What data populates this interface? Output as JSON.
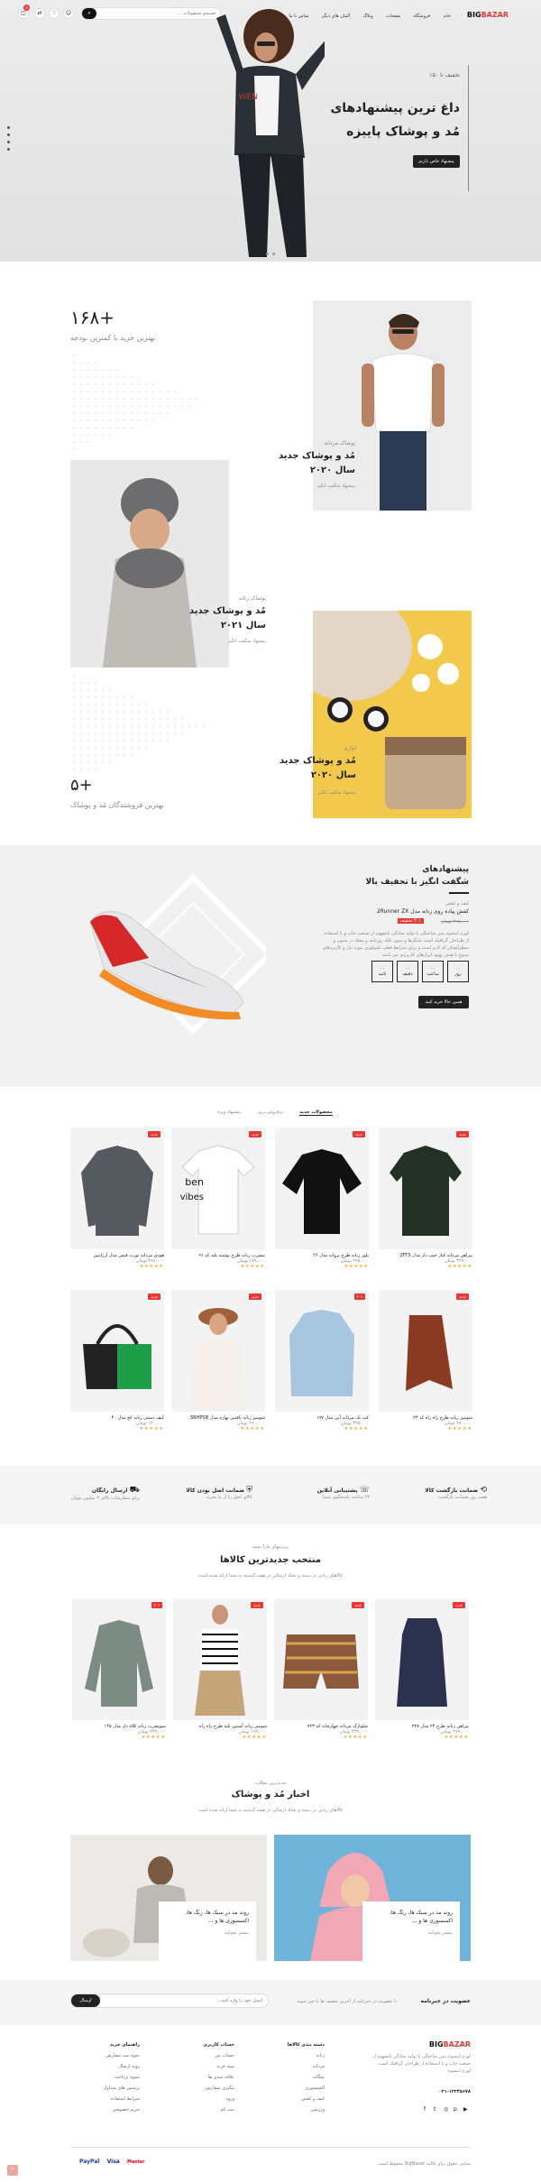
{
  "header": {
    "logo_main": "BIG",
    "logo_accent": "BAZAR",
    "nav": [
      "خانه",
      "فروشگاه",
      "صفحات",
      "وبلاگ",
      "المان های دیگر",
      "تماس با ما"
    ],
    "search_placeholder": "جستجو محصولات ...",
    "cart_count": "0"
  },
  "hero": {
    "eyebrow": "تخفیف تا ۵۰٪",
    "title_line1": "داغ ترین پیشنهادهای",
    "title_line2": "مُد و پوشاک پاییزه",
    "cta": "پیشنهاد خاص داریم"
  },
  "promo": {
    "stat1_value": "۱۶۸+",
    "stat1_label": "بهترین خرید با کمترین بودجه",
    "block1_kicker": "پوشاک مردانه",
    "block1_title1": "مُد و پوشاک جدید",
    "block1_title2": "سال ۲۰۲۰",
    "block1_link": "پیشنهاد شگفت انگیز",
    "block2_kicker": "پوشاک زنانه",
    "block2_title1": "مُد و پوشاک جدید",
    "block2_title2": "سال ۲۰۲۱",
    "block2_link": "پیشنهاد شگفت انگیز",
    "block3_kicker": "لوازم",
    "block3_title1": "مُد و پوشاک جدید",
    "block3_title2": "سال ۲۰۲۰",
    "block3_link": "پیشنهاد شگفت انگیز",
    "stat2_value": "۵+",
    "stat2_label": "بهترین فروشندگان مُد و پوشاک"
  },
  "deal": {
    "title1": "پیشنهادهای",
    "title2": "شگفت انگیز با تخفیف بالا",
    "kicker": "کیف و کفش",
    "product": "کفش پیاده روی زنانه مدل 2Runner ZX",
    "old_price": "۲۹۸,۰۰۰ تومان",
    "badge": "۳۰٪ تخفیف",
    "desc": "لورم ایپسوم متن ساختگی با تولید سادگی نامفهوم از صنعت چاپ و با استفاده از طراحان گرافیک است چاپگرها و متون بلکه روزنامه و مجله در ستون و سطرآنچنان که لازم است و برای شرایط فعلی تکنولوژی مورد نیاز و کاربردهای متنوع با هدف بهبود ابزارهای کاربردی می باشد",
    "countdown": [
      {
        "v": "۰۰",
        "l": "روز"
      },
      {
        "v": "۰۰",
        "l": "ساعت"
      },
      {
        "v": "۰۰",
        "l": "دقیقه"
      },
      {
        "v": "۰۰",
        "l": "ثانیه"
      }
    ],
    "cta": "همین حالا خرید کنید"
  },
  "tabs": [
    "محصولات جدید",
    "پرفروش ترین",
    "پیشنهاد ویژه"
  ],
  "products_grid": [
    {
      "name": "پیراهن مردانه کنار جیب دار مدل 2FTS",
      "price": "۳۳۸,۰۰۰ تومان",
      "tag": "جدید"
    },
    {
      "name": "بلوز زنانه طرح پروانه مدل ۴۶",
      "price": "۲۹۸,۰۰۰ تومان",
      "tag": "جدید"
    },
    {
      "name": "تیشرت زنانه طرح نوشته بلند کد ۹۱",
      "price": "۱۷۹,۰۰۰ تومان",
      "tag": "جدید"
    },
    {
      "name": "هودی مردانه نورث فیس مدل آرژانتین",
      "price": "۴۹۸,۰۰۰ تومان",
      "tag": "جدید"
    },
    {
      "name": "شومیز زنانه طرح راه راه کد ۲۳",
      "price": "۲۸۰,۰۰۰ تومان",
      "tag": "جدید"
    },
    {
      "name": "کت تک مردانه آبی مدل ۱۹۷",
      "price": "۳۴۵,۰۰۰ تومان",
      "tag": "۲۰٪"
    },
    {
      "name": "شومیز زنانه بافتنی بهاره مدل SBHPSN",
      "price": "۶۹۰,۰۰۰ تومان",
      "tag": "جدید"
    },
    {
      "name": "کیف دستی زنانه کج مدل ۴۰",
      "price": "۱۴۰,۰۰۰ تومان",
      "tag": "جدید"
    }
  ],
  "features": [
    {
      "title": "ضمانت بازگشت کالا",
      "sub": "هفت روز ضمانت بازگشت"
    },
    {
      "title": "پشتیبانی آنلاین",
      "sub": "۲۴ ساعت پاسخگوی شما"
    },
    {
      "title": "ضمانت اصل بودن کالا",
      "sub": "کالای اصل را از ما بخرید"
    },
    {
      "title": "ارسال رایگان",
      "sub": "برای سفارشات بالای ۲ میلیون تومان"
    }
  ],
  "selection": {
    "kicker": "برترینهای مارا ببینید",
    "title": "منتخب جدیدترین کالاها",
    "sub": "کالاهای زنانی در دسته و تعداد ارسالی در هفته گذشته به شما ارائه شده است",
    "items": [
      {
        "name": "پیراهن زنانه طرح ۲۴ مدل ۲۲۸",
        "price": "۲۶۹,۰۰۰ تومان",
        "tag": "جدید"
      },
      {
        "name": "شلوارک مردانه چهارخانه کد ۷۲۳",
        "price": "۲۳۹,۰۰۰ تومان",
        "tag": "جدید"
      },
      {
        "name": "شومیز زنانه آستین بلند طرح راه راه",
        "price": "۱۹۹,۰۰۰ تومان",
        "tag": "جدید"
      },
      {
        "name": "سویشرت زنانه کلاه دار مدل ۱۴۵",
        "price": "۲۳۹,۰۰۰ تومان",
        "tag": "۲۰٪"
      }
    ]
  },
  "blog": {
    "kicker": "جدیدترین مقالات",
    "title": "اخبار مُد و پوشاک",
    "sub": "کالاهای زنانی در دسته و تعداد ارسالی در هفته گذشته به شما ارائه شده است",
    "posts": [
      {
        "title": "روند مد در سبک ها، رنگ ها، اکسسوری ها و ...",
        "link": "بیشتر بخوانید"
      },
      {
        "title": "روند مد در سبک ها، رنگ ها، اکسسوری ها و ...",
        "link": "بیشتر بخوانید"
      }
    ]
  },
  "newsletter": {
    "title": "عضویت در خبرنامه",
    "sub": "با عضویت در خبرنامه از آخرین تخفیف ها با خبر شوید",
    "placeholder": "ایمیل خود را وارد کنید...",
    "btn": "ارسال"
  },
  "footer": {
    "about": "لورم ایپسوم متن ساختگی با تولید سادگی نامفهوم از صنعت چاپ و با استفاده از طراحان گرافیک است. لورم ایپسوم",
    "phone": "۰۲۱-۱۲۳۴۵۶۷۸",
    "col1_title": "دسته بندی کالاها",
    "col1": [
      "زنانه",
      "مردانه",
      "بچگانه",
      "اکسسوری",
      "کیف و کفش",
      "ورزشی"
    ],
    "col2_title": "حساب کاربری",
    "col2": [
      "حساب من",
      "سبد خرید",
      "علاقه مندی ها",
      "پیگیری سفارش",
      "ورود",
      "ثبت نام"
    ],
    "col3_title": "راهنمای خرید",
    "col3": [
      "نحوه ثبت سفارش",
      "رویه ارسال",
      "شیوه پرداخت",
      "پرسش های متداول",
      "شرایط استفاده",
      "حریم خصوصی"
    ],
    "copyright": "تمامی حقوق برای قالب BigBazar محفوظ است",
    "payments": [
      "PayPal",
      "Visa",
      "Master"
    ]
  }
}
